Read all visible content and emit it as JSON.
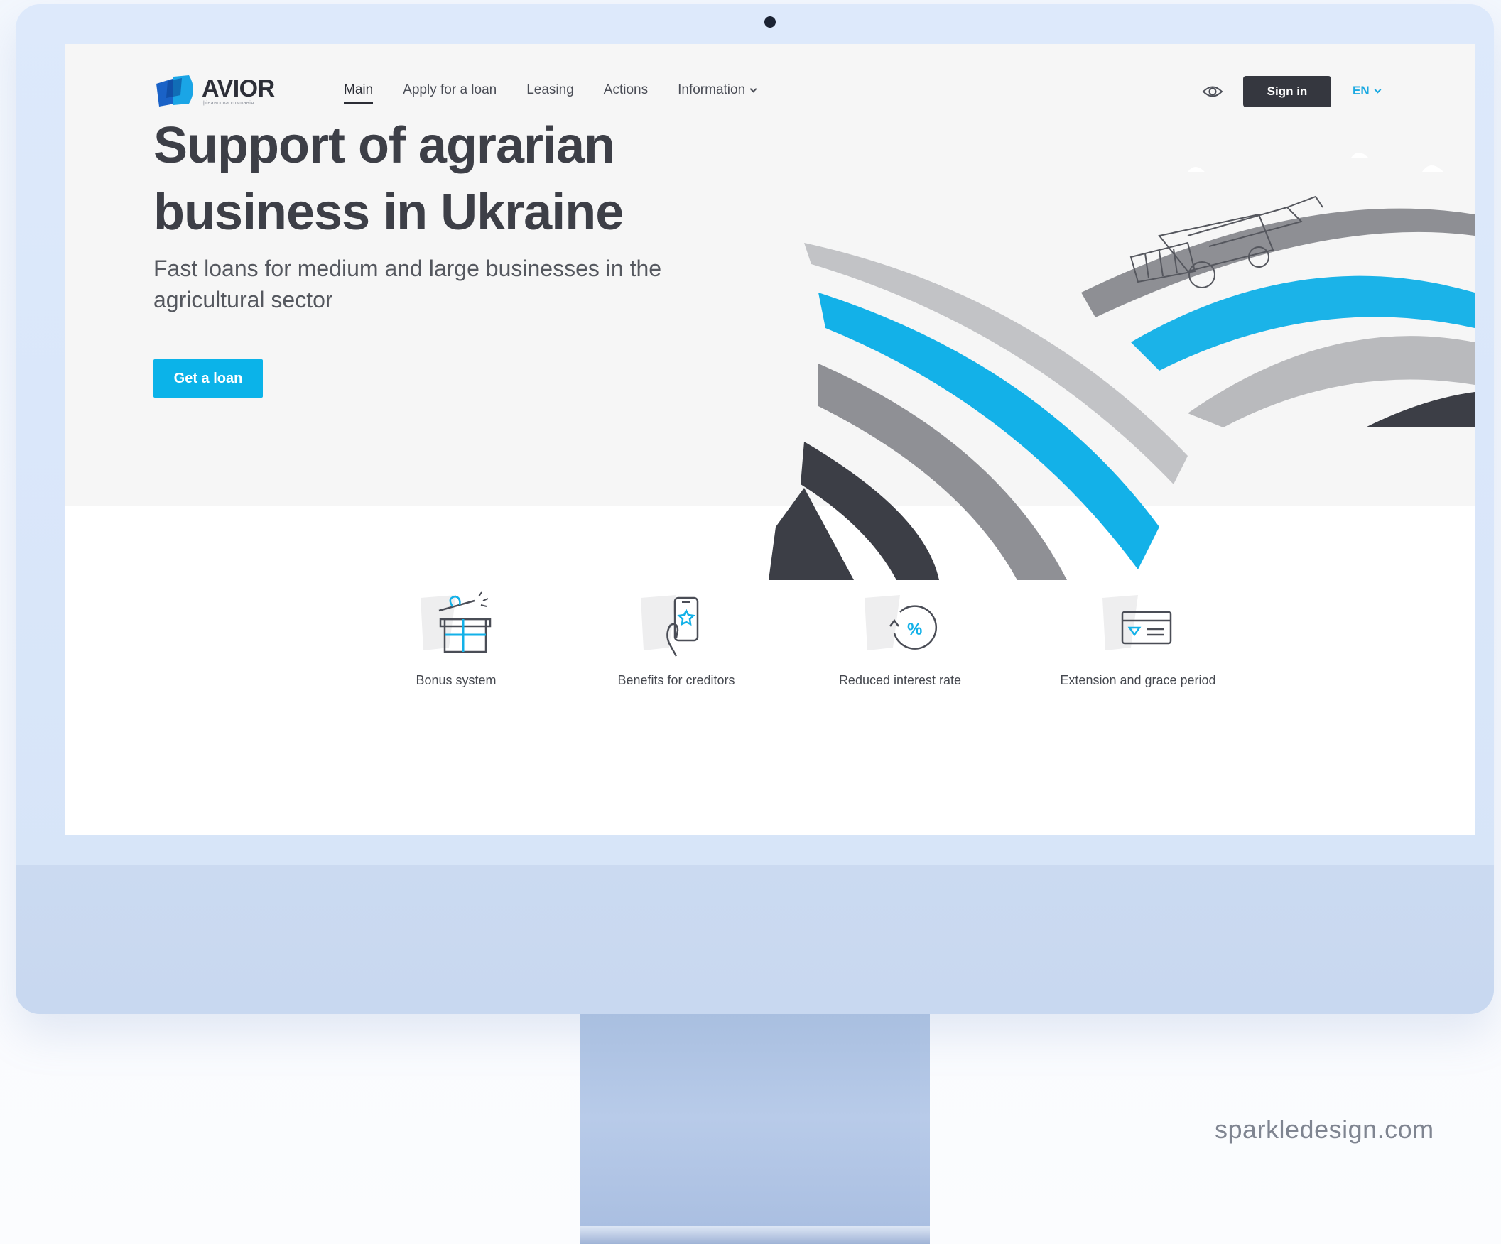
{
  "brand": {
    "name": "AVIOR",
    "tagline": "фінансова компанія",
    "accent_color": "#0bb3e9",
    "dark_color": "#35373f"
  },
  "nav": {
    "items": [
      {
        "label": "Main",
        "active": true
      },
      {
        "label": "Apply for a loan",
        "active": false
      },
      {
        "label": "Leasing",
        "active": false
      },
      {
        "label": "Actions",
        "active": false
      },
      {
        "label": "Information",
        "active": false,
        "has_dropdown": true
      }
    ]
  },
  "header": {
    "accessibility_icon": "eye-icon",
    "sign_in_label": "Sign in",
    "language": "EN"
  },
  "hero": {
    "title": "Support of agrarian business in Ukraine",
    "subtitle": "Fast loans for medium and large businesses in the agricultural sector",
    "cta_label": "Get a loan"
  },
  "features": [
    {
      "label": "Bonus system",
      "icon": "gift-icon"
    },
    {
      "label": "Benefits for creditors",
      "icon": "phone-hand-icon"
    },
    {
      "label": "Reduced interest rate",
      "icon": "percent-cycle-icon"
    },
    {
      "label": "Extension and grace period",
      "icon": "card-icon"
    }
  ],
  "watermark": "sparkledesign.com"
}
